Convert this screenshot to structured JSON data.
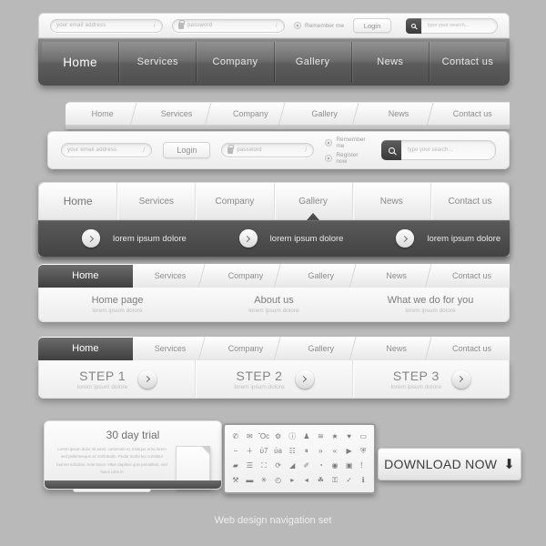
{
  "caption": "Web design navigation set",
  "menu": [
    "Home",
    "Services",
    "Company",
    "Gallery",
    "News",
    "Contact us"
  ],
  "block1": {
    "email_placeholder": "your email address",
    "password_placeholder": "password",
    "remember_label": "Remember me",
    "login_label": "Login",
    "search_placeholder": "type your search...",
    "items": [
      "Home",
      "Services",
      "Company",
      "Gallery",
      "News",
      "Contact us"
    ]
  },
  "block2": {
    "items": [
      "Home",
      "Services",
      "Company",
      "Gallery",
      "News",
      "Contact us"
    ],
    "email_placeholder": "your email address",
    "login_label": "Login",
    "password_placeholder": "password",
    "remember_label": "Remember me",
    "register_label": "Register now",
    "search_placeholder": "type your search..."
  },
  "block3": {
    "items": [
      "Home",
      "Services",
      "Company",
      "Gallery",
      "News",
      "Contact us"
    ],
    "active": "Gallery",
    "promos": [
      "lorem ipsum dolore",
      "lorem ipsum dolore",
      "lorem ipsum dolore"
    ]
  },
  "block4": {
    "items": [
      "Home",
      "Services",
      "Company",
      "Gallery",
      "News",
      "Contact us"
    ],
    "columns": [
      {
        "title": "Home page",
        "sub": "lorem ipsum dolore"
      },
      {
        "title": "About us",
        "sub": "lorem ipsum dolore"
      },
      {
        "title": "What we do for you",
        "sub": "lorem ipsum dolore"
      }
    ]
  },
  "block5": {
    "items": [
      "Home",
      "Services",
      "Company",
      "Gallery",
      "News",
      "Contact us"
    ],
    "steps": [
      {
        "title": "STEP 1",
        "sub": "lorem ipsum dolore"
      },
      {
        "title": "STEP 2",
        "sub": "lorem ipsum dolore"
      },
      {
        "title": "STEP 3",
        "sub": "lorem ipsum dolore"
      }
    ]
  },
  "trial": {
    "title": "30 day trial",
    "text": "Lorem ipsum dolor sit amet, commodo et, tristique urna lorem sed pellentesque ac sollicitudin. Pedar morbi leo curabitur laoreet ridiculus. Ante lacus. Vitae dapibus quis penatibus, sed fusce urna in",
    "button": "Download now"
  },
  "icons": [
    "phone-icon",
    "envelope-icon",
    "briefcase-icon",
    "gear-icon",
    "info-icon",
    "user-icon",
    "rss-icon",
    "star-icon",
    "heart-icon",
    "comment-icon",
    "minus-icon",
    "plus-icon",
    "mute-icon",
    "volume-icon",
    "sliders-icon",
    "pause-icon",
    "forward-icon",
    "backward-icon",
    "play-icon",
    "shield-icon",
    "folder-icon",
    "list-icon",
    "expand-icon",
    "refresh-icon",
    "tag-icon",
    "edit-icon",
    "chart-icon",
    "eye-icon",
    "save-icon",
    "exclamation-icon",
    "tools-icon",
    "camera-icon",
    "sun-icon",
    "clock-icon",
    "next-icon",
    "prev-icon",
    "trash-icon",
    "lock-icon",
    "check-icon",
    "link-icon"
  ],
  "icon_glyphs": [
    "✆",
    "✉",
    "Ὃc",
    "⚙",
    "ⓘ",
    "♟",
    "≋",
    "★",
    "♥",
    "▭",
    "−",
    "＋",
    "ὐ7",
    "ὐa",
    "☷",
    "⏸",
    "»",
    "«",
    "▶",
    "⛨",
    "▰",
    "☰",
    "⛶",
    "⟳",
    "◢",
    "✐",
    "◔",
    "◉",
    "▣",
    "！",
    "⚒",
    "▬",
    "✳",
    "◴",
    "▸",
    "◂",
    "☘",
    "⚿",
    "✓",
    "ℹ"
  ],
  "download": {
    "label": "DOWNLOAD NOW",
    "icon": "⬇"
  }
}
